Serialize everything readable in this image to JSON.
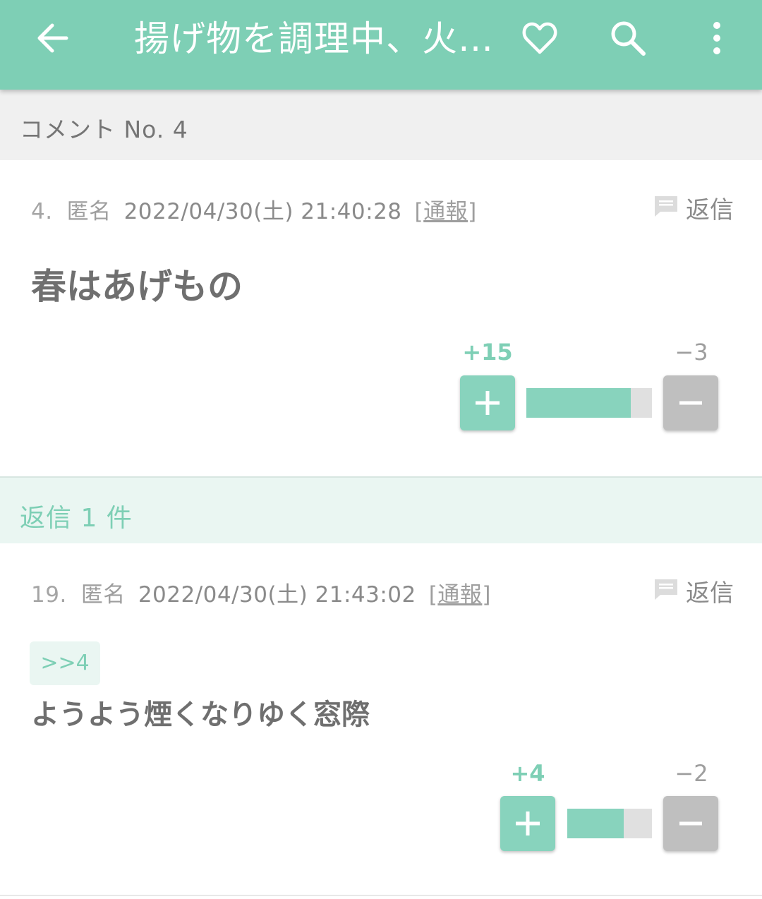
{
  "app_bar": {
    "title": "揚げ物を調理中、火…",
    "back_icon": "arrow-left-icon",
    "favorite_icon": "heart-outline-icon",
    "search_icon": "search-icon",
    "more_icon": "more-vertical-icon",
    "background_color": "#7ecfb5"
  },
  "comment_header": "コメント No. 4",
  "comment": {
    "number": "4.",
    "name": "匿名",
    "datetime": "2022/04/30(土) 21:40:28",
    "report_open": "[",
    "report_label": "通報",
    "report_close": "]",
    "reply_label": "返信",
    "text": "春はあげもの",
    "plus_count": "+15",
    "minus_count": "−3",
    "plus_ratio": 0.833
  },
  "replies_header": "返信 1 件",
  "replies": [
    {
      "number": "19.",
      "name": "匿名",
      "datetime": "2022/04/30(土) 21:43:02",
      "report_open": "[",
      "report_label": "通報",
      "report_close": "]",
      "reply_label": "返信",
      "anchor": ">>4",
      "text": "ようよう煙くなりゆく窓際",
      "plus_count": "+4",
      "minus_count": "−2",
      "plus_ratio": 0.667
    }
  ],
  "colors": {
    "accent": "#7ecfb5",
    "plus_button": "#88d3bd",
    "minus_button": "#bfbfbf",
    "header_bg": "#f0f0f0",
    "reply_header_bg": "#eaf6f2"
  }
}
